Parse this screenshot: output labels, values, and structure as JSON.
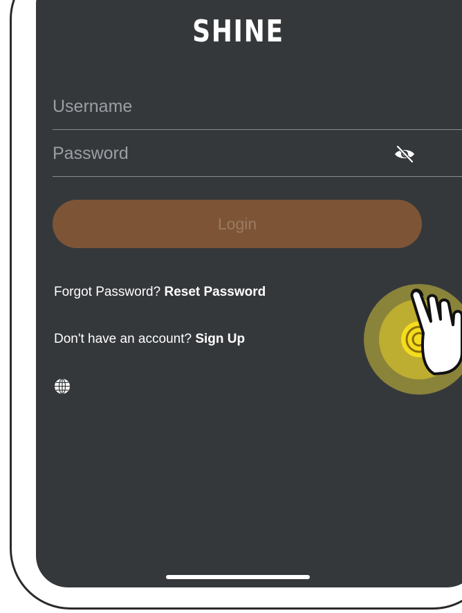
{
  "app": {
    "logo_text": "SHINE"
  },
  "login_form": {
    "username_placeholder": "Username",
    "username_value": "",
    "password_placeholder": "Password",
    "password_value": "",
    "password_visibility_icon": "eye-off-icon",
    "login_label": "Login"
  },
  "links": {
    "forgot_prompt": "Forgot Password?",
    "reset_label": "Reset Password",
    "signup_prompt": "Don't have an account?",
    "signup_label": "Sign Up"
  },
  "language": {
    "icon": "globe-icon"
  },
  "colors": {
    "screen_background": "#35383b",
    "login_button": "#7d5536",
    "login_button_text": "#9b7a60",
    "tap_highlight": "#f2df3a"
  }
}
